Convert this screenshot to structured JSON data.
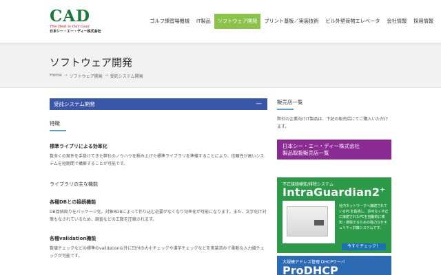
{
  "logo": {
    "main": "CAD",
    "tagline": "The Best is Our Goal",
    "company_jp": "日本シー・エー・ディー株式会社"
  },
  "nav": [
    "ゴルフ練習場機械",
    "IT製品",
    "ソフトウェア開発",
    "プリント基板／実装技術",
    "ビル外壁荷物エレベータ",
    "会社情報",
    "採用情報"
  ],
  "nav_active": "ソフトウェア開発",
  "page": {
    "title": "ソフトウェア開発",
    "breadcrumb": [
      "Home",
      "ソフトウェア開発",
      "受託システム開発"
    ],
    "breadcrumb_sep": "→"
  },
  "accordion": {
    "title": "受託システム開発",
    "toggle": "—"
  },
  "content": {
    "section_title": "特徴",
    "h1": "標準ライブリによる効率化",
    "p1": "数多くの案件を手掛けてきた弊社のノウハウを積み上げた標準ライブラリを準備することにより、信頼性が高いシステムを短期間で構築することが可能です。",
    "h2": "ライブラリの主な機能",
    "h3": "各種DBとの接続機能",
    "p3": "DB接続周りをパッケージ化。対象RDBによって作り込む必要がなくなり効率化が可能になります。また、文字化け対策もなされているため、調査などの工数を圧縮されます。",
    "h4": "各種validation機能",
    "p4": "数値チェックなどの標準のvalidation以外に日付の大小チェックや漢字チェックなどを実装済みで柔軟な入力値チェックが可能です。"
  },
  "sidebar": {
    "title": "販売店一覧",
    "text": "弊社の企業向けIT製品は、下記の販売店にてご購入いただけます。",
    "link_line1": "日本シー・エー・ディー株式会社",
    "link_line2": "製品取扱販売店一覧"
  },
  "banner": {
    "top": "不正接続検知/排除システム",
    "name": "IntraGuardian2",
    "sup": "+",
    "desc": "社内ネットワークへ接続されているPCを監視し、許可なく不正に接続されたPCを自動的に検知・排除するための強力なセキュリティ対策システムです。",
    "button": "今すぐチェック！"
  },
  "banner2": {
    "top": "大規模アドレス管理 DHCPサーバ",
    "name": "ProDHCP"
  }
}
